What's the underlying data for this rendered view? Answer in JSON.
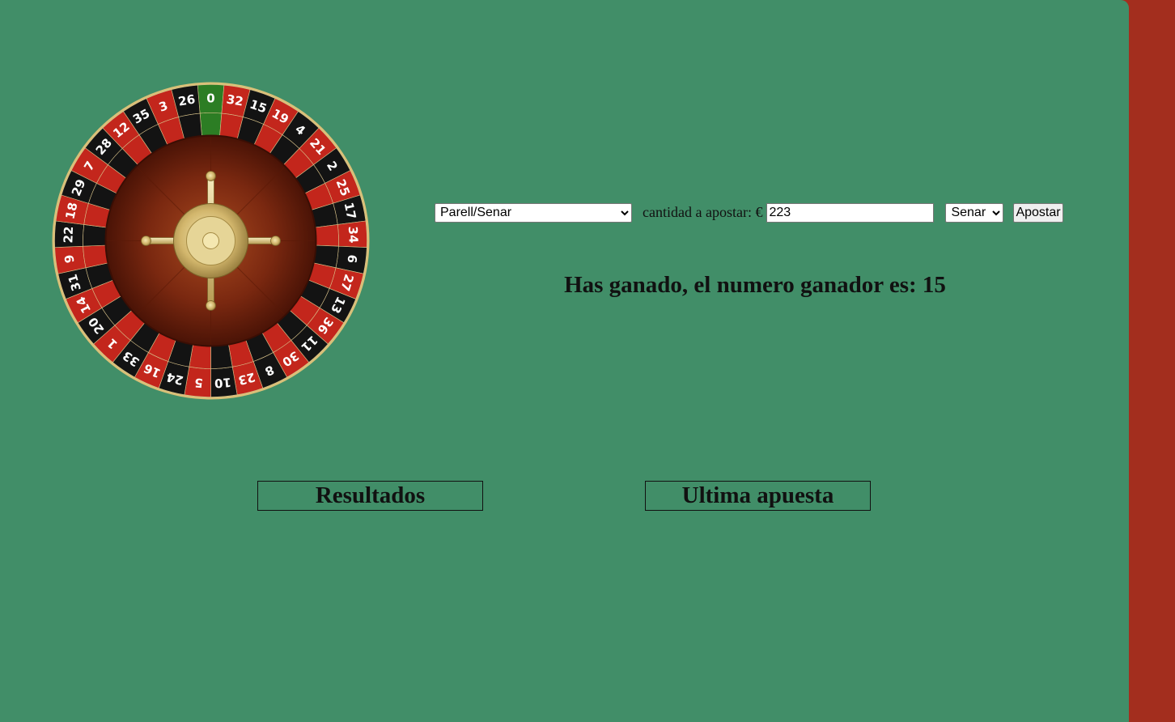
{
  "wheel": {
    "numbers": [
      "0",
      "32",
      "15",
      "19",
      "4",
      "21",
      "2",
      "25",
      "17",
      "34",
      "6",
      "27",
      "13",
      "36",
      "11",
      "30",
      "8",
      "23",
      "10",
      "5",
      "24",
      "16",
      "33",
      "1",
      "20",
      "14",
      "31",
      "9",
      "22",
      "18",
      "29",
      "7",
      "28",
      "12",
      "35",
      "3",
      "26"
    ],
    "colors": [
      "green",
      "red",
      "black",
      "red",
      "black",
      "red",
      "black",
      "red",
      "black",
      "red",
      "black",
      "red",
      "black",
      "red",
      "black",
      "red",
      "black",
      "red",
      "black",
      "red",
      "black",
      "red",
      "black",
      "red",
      "black",
      "red",
      "black",
      "red",
      "black",
      "red",
      "black",
      "red",
      "black",
      "red",
      "black",
      "red",
      "black"
    ],
    "palette": {
      "red": "#c3261c",
      "black": "#131313",
      "green": "#2c7d24",
      "gold": "#d9c078",
      "wood": "#6a1e0d"
    }
  },
  "bet_form": {
    "bet_type_selected": "Parell/Senar",
    "amount_label": "cantidad a apostar: €",
    "amount_value": "223",
    "choice_selected": "Senar",
    "submit_label": "Apostar"
  },
  "result_message": "Has ganado, el numero ganador es: 15",
  "sections": {
    "results_label": "Resultados",
    "last_bet_label": "Ultima apuesta"
  },
  "colors": {
    "table_green": "#418e68",
    "sidebar_red": "#a32e1e"
  }
}
